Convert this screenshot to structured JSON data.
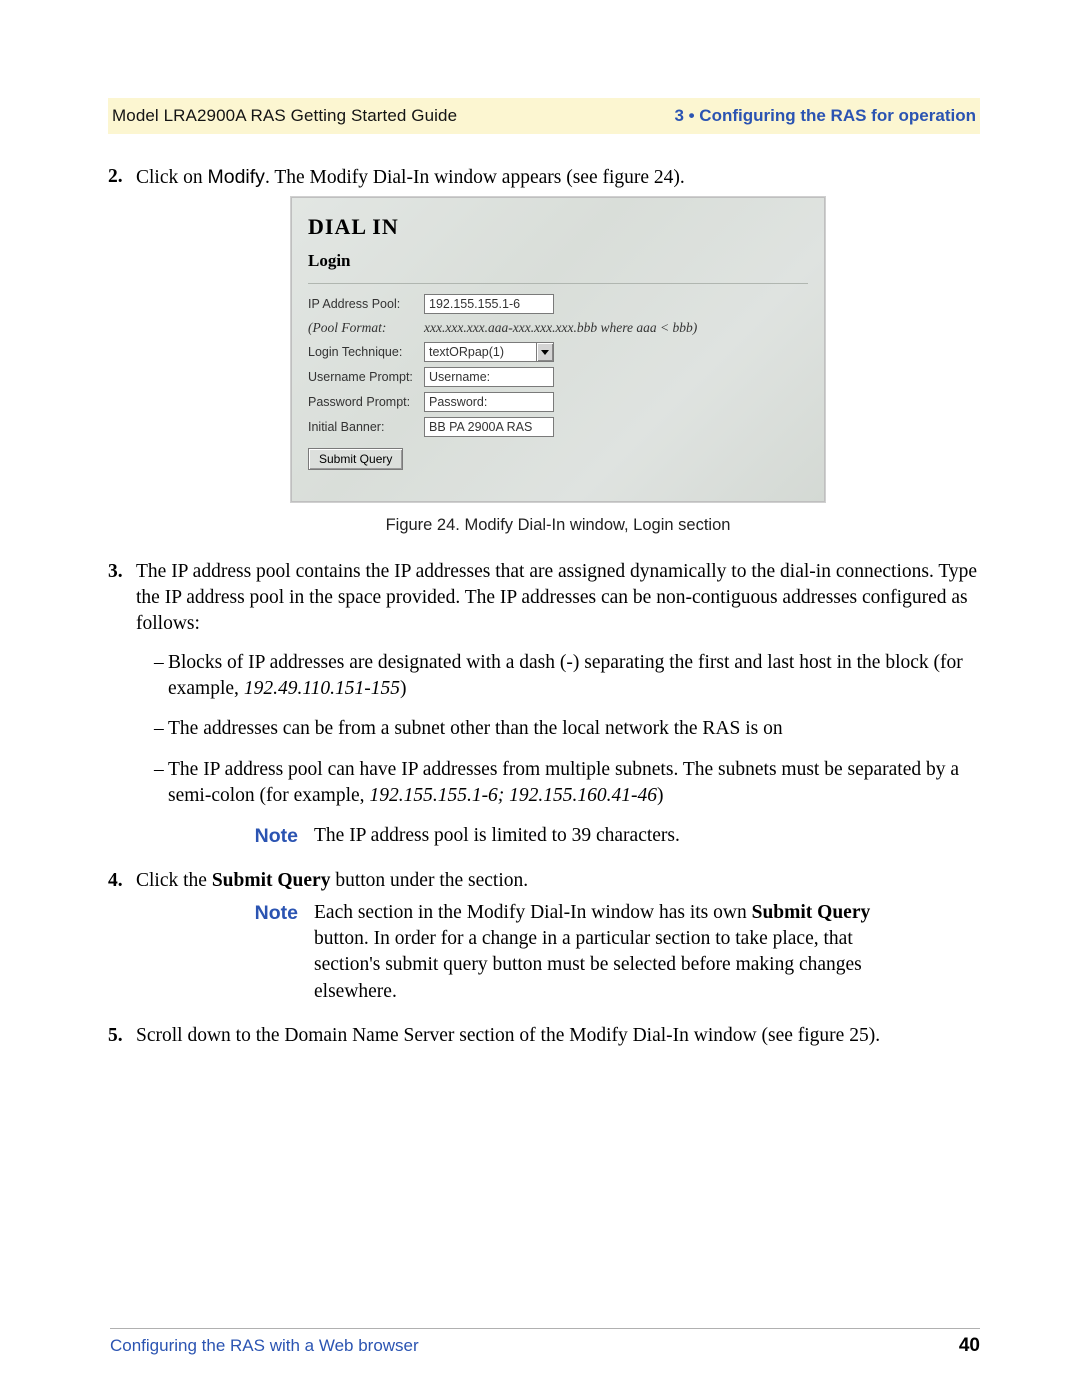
{
  "header": {
    "left": "Model LRA2900A RAS Getting Started Guide",
    "right": "3 • Configuring the RAS for operation"
  },
  "steps": {
    "step2": {
      "prefix": "Click on ",
      "modify_word": "Modify",
      "suffix": ". The Modify Dial-In window appears (see figure 24)."
    },
    "step3_intro": "The IP address pool contains the IP addresses that are assigned dynamically to the dial-in connections. Type the IP address pool in the space provided. The IP addresses can be non-contiguous addresses configured as follows:",
    "step3_bullets": [
      {
        "pre": "Blocks of IP addresses are designated with a dash (-) separating the first and last host in the block (for example, ",
        "italic": "192.49.110.151-155",
        "post": ")"
      },
      {
        "pre": "The addresses can be from a subnet other than the local network the RAS is on",
        "italic": "",
        "post": ""
      },
      {
        "pre": "The IP address pool can have IP addresses from multiple subnets. The subnets must be separated by a semi-colon (for example, ",
        "italic": "192.155.155.1-6; 192.155.160.41-46",
        "post": ")"
      }
    ],
    "note1": {
      "label": "Note",
      "text": "The IP address pool is limited to 39 characters."
    },
    "step4": {
      "pre": "Click the ",
      "bold": "Submit Query",
      "post": " button under the section."
    },
    "note2": {
      "label": "Note",
      "pre": "Each section in the Modify Dial-In window has its own ",
      "bold": "Submit Query",
      "post": " button. In order for a change in a particular section to take place, that section's submit query button must be selected before making changes elsewhere."
    },
    "step5": "Scroll down to the Domain Name Server section of the Modify Dial-In window (see figure 25)."
  },
  "figure": {
    "title": "DIAL IN",
    "subtitle": "Login",
    "rows": {
      "ip_pool_label": "IP Address Pool:",
      "ip_pool_value": "192.155.155.1-6",
      "pool_format_label": "(Pool Format:",
      "pool_format_value": "xxx.xxx.xxx.aaa-xxx.xxx.xxx.bbb where aaa < bbb)",
      "login_tech_label": "Login Technique:",
      "login_tech_value": "textORpap(1)",
      "username_prompt_label": "Username Prompt:",
      "username_prompt_value": "Username:",
      "password_prompt_label": "Password Prompt:",
      "password_prompt_value": "Password:",
      "initial_banner_label": "Initial Banner:",
      "initial_banner_value": "BB PA 2900A RAS"
    },
    "submit_label": "Submit Query",
    "caption": "Figure 24. Modify Dial-In window, Login section"
  },
  "footer": {
    "left": "Configuring the RAS with a Web browser",
    "right": "40"
  }
}
